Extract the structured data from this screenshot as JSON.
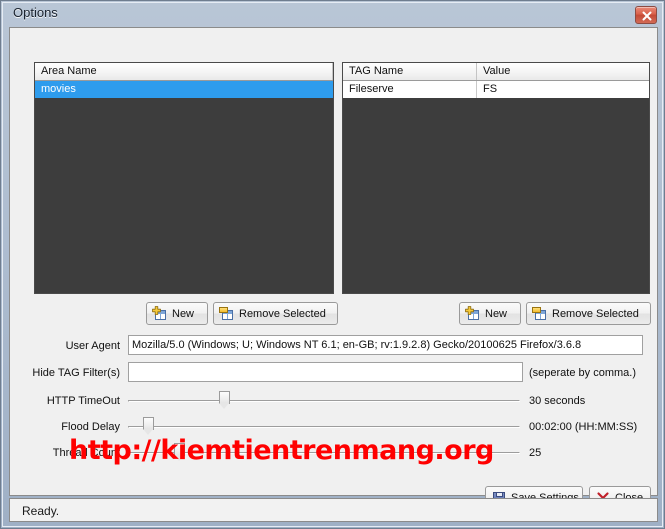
{
  "window": {
    "title": "Options",
    "close_icon": "close-icon"
  },
  "area_list": {
    "columns": [
      "Area Name"
    ],
    "rows": [
      {
        "cells": [
          "movies"
        ],
        "selected": true
      }
    ],
    "buttons": {
      "new_label": "New",
      "remove_label": "Remove Selected"
    }
  },
  "tag_list": {
    "columns": [
      "TAG Name",
      "Value"
    ],
    "rows": [
      {
        "cells": [
          "Fileserve",
          "FS"
        ],
        "selected": false
      }
    ],
    "buttons": {
      "new_label": "New",
      "remove_label": "Remove Selected"
    }
  },
  "form": {
    "user_agent": {
      "label": "User Agent",
      "value": "Mozilla/5.0 (Windows; U; Windows NT 6.1; en-GB; rv:1.9.2.8) Gecko/20100625 Firefox/3.6.8",
      "placeholder": ""
    },
    "hide_tag_filters": {
      "label": "Hide TAG Filter(s)",
      "value": "",
      "placeholder": "",
      "hint": "(seperate by comma.)"
    },
    "http_timeout": {
      "label": "HTTP TimeOut",
      "value": "30 seconds",
      "percent": 24
    },
    "flood_delay": {
      "label": "Flood Delay",
      "value": "00:02:00 (HH:MM:SS)",
      "percent": 4
    },
    "thread_count": {
      "label": "Thread Count",
      "value": "25",
      "percent": 12
    }
  },
  "footer": {
    "save_label": "Save Settings",
    "close_label": "Close"
  },
  "statusbar": {
    "text": "Ready."
  },
  "watermark": {
    "text": "http://kiemtientrenmang.org",
    "color": "#ff0000"
  },
  "colors": {
    "selection": "#2e9ced",
    "list_background": "#3d3d3d",
    "close_button": "#c44a36"
  }
}
